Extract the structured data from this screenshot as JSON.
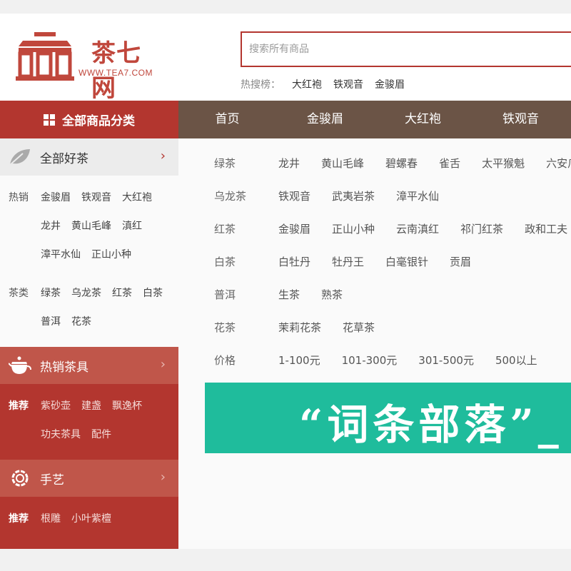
{
  "header": {
    "logo_text": "茶七网",
    "logo_url": "WWW.TEA7.COM",
    "search_placeholder": "搜索所有商品",
    "hot_label": "热搜榜：",
    "hot_terms": [
      "大红袍",
      "铁观音",
      "金骏眉"
    ]
  },
  "nav": {
    "all_categories": "全部商品分类",
    "links": [
      "首页",
      "金骏眉",
      "大红袍",
      "铁观音"
    ]
  },
  "sidebar": {
    "tea": {
      "title": "全部好茶",
      "hot_label": "热销",
      "hot_items": [
        "金骏眉",
        "铁观音",
        "大红袍",
        "龙井",
        "黄山毛峰",
        "滇红",
        "漳平水仙",
        "正山小种"
      ],
      "type_label": "茶类",
      "type_items": [
        "绿茶",
        "乌龙茶",
        "红茶",
        "白茶",
        "普洱",
        "花茶"
      ]
    },
    "teaware": {
      "title": "热销茶具",
      "rec_label": "推荐",
      "items": [
        "紫砂壶",
        "建盏",
        "飘逸杯",
        "功夫茶具",
        "配件"
      ]
    },
    "craft": {
      "title": "手艺",
      "rec_label": "推荐",
      "items": [
        "根雕",
        "小叶紫檀"
      ]
    }
  },
  "categories": [
    {
      "name": "绿茶",
      "items": [
        "龙井",
        "黄山毛峰",
        "碧螺春",
        "雀舌",
        "太平猴魁",
        "六安瓜片"
      ]
    },
    {
      "name": "乌龙茶",
      "items": [
        "铁观音",
        "武夷岩茶",
        "漳平水仙"
      ]
    },
    {
      "name": "红茶",
      "items": [
        "金骏眉",
        "正山小种",
        "云南滇红",
        "祁门红茶",
        "政和工夫"
      ]
    },
    {
      "name": "白茶",
      "items": [
        "白牡丹",
        "牡丹王",
        "白毫银针",
        "贡眉"
      ]
    },
    {
      "name": "普洱",
      "items": [
        "生茶",
        "熟茶"
      ]
    },
    {
      "name": "花茶",
      "items": [
        "茉莉花茶",
        "花草茶"
      ]
    },
    {
      "name": "价格",
      "items": [
        "1-100元",
        "101-300元",
        "301-500元",
        "500以上"
      ]
    }
  ],
  "banner": {
    "text": "“词条部落”_"
  },
  "colors": {
    "brand_red": "#b3362f",
    "nav_brown": "#6b5446",
    "banner_green": "#1fbc9c"
  }
}
